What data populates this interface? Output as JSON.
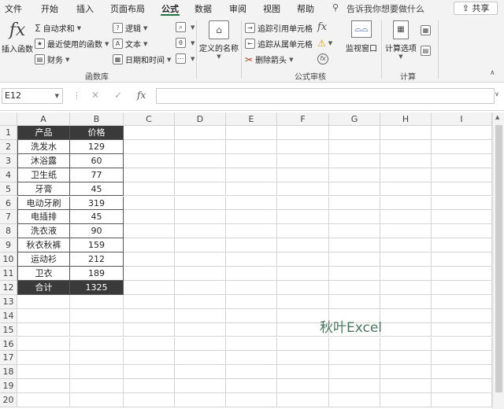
{
  "menu_tabs": [
    "文件",
    "开始",
    "插入",
    "页面布局",
    "公式",
    "数据",
    "审阅",
    "视图",
    "帮助"
  ],
  "active_tab": "公式",
  "tell_me": "告诉我你想要做什么",
  "share": "共享",
  "ribbon": {
    "insert_function": "插入函数",
    "autosum": "自动求和",
    "recent": "最近使用的函数",
    "financial": "财务",
    "logical": "逻辑",
    "text": "文本",
    "datetime": "日期和时间",
    "defined_names": "定义的名称",
    "trace_precedents": "追踪引用单元格",
    "trace_dependents": "追踪从属单元格",
    "remove_arrows": "删除箭头",
    "watch_window": "监视窗口",
    "calc_options": "计算选项",
    "group_function_library": "函数库",
    "group_formula_auditing": "公式审核",
    "group_calculation": "计算"
  },
  "formula_bar": {
    "name_box": "E12",
    "fx_label": "fx",
    "formula": ""
  },
  "columns": [
    "A",
    "B",
    "C",
    "D",
    "E",
    "F",
    "G",
    "H",
    "I"
  ],
  "rows": [
    "1",
    "2",
    "3",
    "4",
    "5",
    "6",
    "7",
    "8",
    "9",
    "10",
    "11",
    "12",
    "13",
    "14",
    "15",
    "16",
    "17",
    "18",
    "19",
    "20"
  ],
  "table": {
    "header": [
      "产品",
      "价格"
    ],
    "rows": [
      [
        "洗发水",
        "129"
      ],
      [
        "沐浴露",
        "60"
      ],
      [
        "卫生纸",
        "77"
      ],
      [
        "牙膏",
        "45"
      ],
      [
        "电动牙刷",
        "319"
      ],
      [
        "电插排",
        "45"
      ],
      [
        "洗衣液",
        "90"
      ],
      [
        "秋衣秋裤",
        "159"
      ],
      [
        "运动衫",
        "212"
      ],
      [
        "卫衣",
        "189"
      ]
    ],
    "total": [
      "合计",
      "1325"
    ]
  },
  "watermark": "秋叶Excel",
  "colors": {
    "accent": "#217346",
    "table_header": "#3a3a3a",
    "watermark": "#4b7561"
  }
}
